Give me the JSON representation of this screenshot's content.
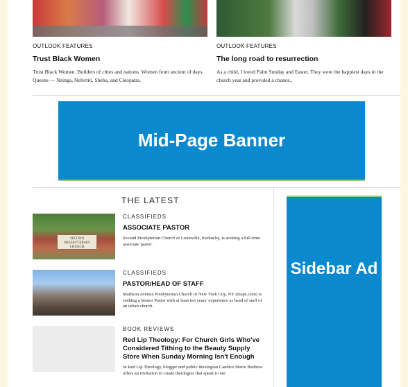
{
  "features": [
    {
      "kicker": "OUTLOOK FEATURES",
      "title": "Trust Black Women",
      "excerpt": "Trust Black Women. Builders of cities and nations. Women from ancient of days. Queens — Nzinga, Nefertiti, Sheba, and Cleopatra."
    },
    {
      "kicker": "OUTLOOK FEATURES",
      "title": "The long road to resurrection",
      "excerpt": "As a child, I loved Palm Sunday and Easter. They were the happiest days in the church year and provided a chance.."
    }
  ],
  "banner": {
    "label": "Mid-Page Banner"
  },
  "latest": {
    "heading": "THE LATEST",
    "items": [
      {
        "category": "CLASSIFIEDS",
        "title": "ASSOCIATE PASTOR",
        "description": "Second Presbyterian Church of Louisville, Kentucky, is seeking a full-time associate pastor.",
        "sign_text": "SECOND PRESBYTERIAN CHURCH"
      },
      {
        "category": "CLASSIFIEDS",
        "title": "PASTOR/HEAD OF STAFF",
        "description": "Madison Avenue Presbyterian Church of New York City, NY (mapc.com) is seeking a Senior Pastor with at least ten years' experience as head of staff of an urban church."
      },
      {
        "category": "BOOK REVIEWS",
        "title": "Red Lip Theology: For Church Girls Who've Considered Tithing to the Beauty Supply Store When Sunday Morning Isn't Enough",
        "description": "In Red Lip Theology, blogger and public theologian Candice Marie Benbow offers an invitation to create theologies that speak to our"
      }
    ]
  },
  "sidebar_ad": {
    "label": "Sidebar Ad"
  },
  "colors": {
    "ad_blue": "#0a89cf",
    "ad_accent": "#9cc98a",
    "page_bg": "#fdf7e2"
  }
}
